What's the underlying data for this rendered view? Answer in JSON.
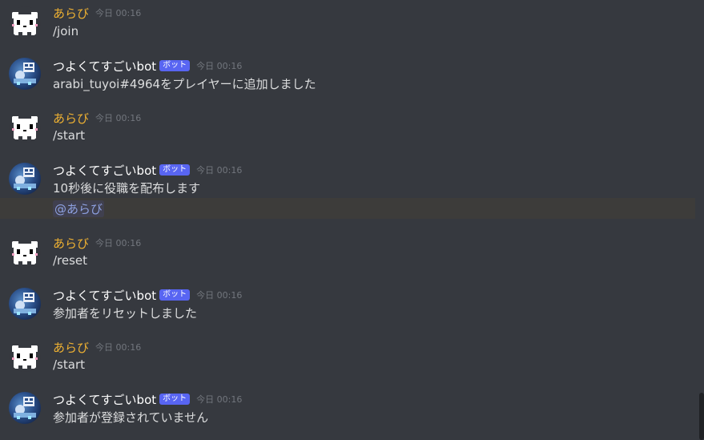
{
  "bot_tag": "ボット",
  "messages": [
    {
      "author": "あらび",
      "type": "user",
      "time": "今日 00:16",
      "text": "/join"
    },
    {
      "author": "つよくてすごいbot",
      "type": "bot",
      "time": "今日 00:16",
      "text": "arabi_tuyoi#4964をプレイヤーに追加しました"
    },
    {
      "author": "あらび",
      "type": "user",
      "time": "今日 00:16",
      "text": "/start"
    },
    {
      "author": "つよくてすごいbot",
      "type": "bot",
      "time": "今日 00:16",
      "text": "10秒後に役職を配布します",
      "mention": "@あらび"
    },
    {
      "author": "あらび",
      "type": "user",
      "time": "今日 00:16",
      "text": "/reset"
    },
    {
      "author": "つよくてすごいbot",
      "type": "bot",
      "time": "今日 00:16",
      "text": "参加者をリセットしました"
    },
    {
      "author": "あらび",
      "type": "user",
      "time": "今日 00:16",
      "text": "/start"
    },
    {
      "author": "つよくてすごいbot",
      "type": "bot",
      "time": "今日 00:16",
      "text": "参加者が登録されていません"
    }
  ],
  "colors": {
    "background": "#36393f",
    "user_name": "#f0b232",
    "bot_name": "#ffffff",
    "bot_tag": "#5865f2",
    "mention": "#8ea1e1",
    "mention_highlight": "#3d3c3a",
    "timestamp": "#72767d",
    "text": "#dcddde"
  },
  "icons": {
    "user_avatar": "pixel-ghost-avatar-icon",
    "bot_avatar": "bot-avatar-icon"
  }
}
